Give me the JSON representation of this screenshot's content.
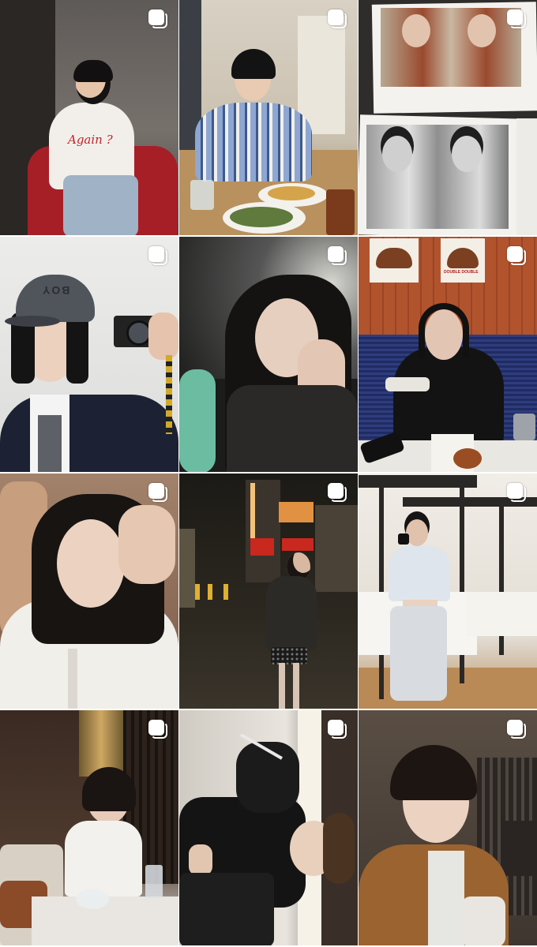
{
  "grid": {
    "tiles": [
      {
        "id": 1,
        "scene": "woman in white 'Again' t-shirt on red armchair",
        "shirt_text": "Again ?",
        "multiple": true,
        "colors": {
          "bg": "#6e6a66",
          "accent": "#b4232a",
          "outfit": "#f2efea"
        }
      },
      {
        "id": 2,
        "scene": "woman in striped cardigan at restaurant table",
        "multiple": true,
        "colors": {
          "bg": "#cfc7b8",
          "accent": "#5b7fb5",
          "outfit": "#7f9bc9"
        }
      },
      {
        "id": 3,
        "scene": "polaroid photos on a table",
        "multiple": true,
        "colors": {
          "bg": "#3c3a38",
          "accent": "#f5f3ef",
          "outfit": "#9a4a2e"
        }
      },
      {
        "id": 4,
        "scene": "woman with cap holding camera, mirror selfie",
        "cap_text": "BOY",
        "multiple": true,
        "colors": {
          "bg": "#e6e6e4",
          "accent": "#50555c",
          "outfit": "#1d2233"
        }
      },
      {
        "id": 5,
        "scene": "close-up portrait in dim light",
        "multiple": true,
        "colors": {
          "bg": "#2c2c2a",
          "accent": "#6fbfa5",
          "outfit": "#1a1a1a"
        }
      },
      {
        "id": 6,
        "scene": "woman in black hoodie at burger restaurant",
        "poster_text": "DOUBLE DOUBLE",
        "multiple": true,
        "colors": {
          "bg": "#b35a34",
          "accent": "#2b3a7a",
          "outfit": "#141414"
        }
      },
      {
        "id": 7,
        "scene": "selfie in white shirt inside car",
        "multiple": true,
        "colors": {
          "bg": "#8a6a55",
          "accent": "#f4f2ee",
          "outfit": "#efede8"
        }
      },
      {
        "id": 8,
        "scene": "night street with neon signs",
        "multiple": true,
        "colors": {
          "bg": "#222018",
          "accent": "#e08a3c",
          "outfit": "#2b2b2b"
        }
      },
      {
        "id": 9,
        "scene": "woman in grey sweatsuit by canopy bed",
        "multiple": true,
        "colors": {
          "bg": "#ece8e2",
          "accent": "#2c2a28",
          "outfit": "#c9cdd3"
        }
      },
      {
        "id": 10,
        "scene": "woman in white top at cafe table",
        "multiple": true,
        "colors": {
          "bg": "#3a2a22",
          "accent": "#f6f3ee",
          "outfit": "#f0efed"
        }
      },
      {
        "id": 11,
        "scene": "woman in black track jacket, rotated photo",
        "multiple": true,
        "colors": {
          "bg": "#d9d4cc",
          "accent": "#111111",
          "outfit": "#1b1b1b"
        }
      },
      {
        "id": 12,
        "scene": "selfie in brown blazer",
        "multiple": true,
        "colors": {
          "bg": "#4a4038",
          "accent": "#8a5a2c",
          "outfit": "#9b6330"
        }
      }
    ]
  }
}
